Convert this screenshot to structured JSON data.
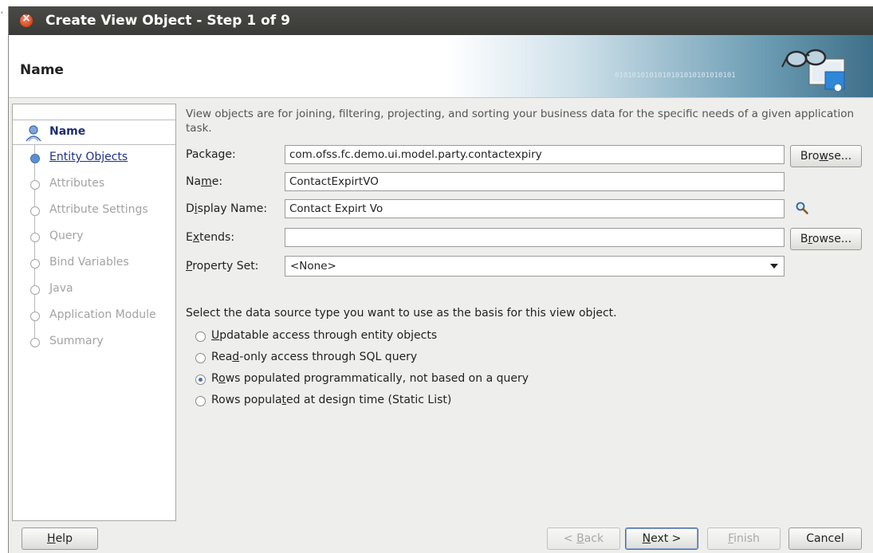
{
  "window": {
    "title": "Create View Object - Step 1 of 9",
    "header_title": "Name",
    "header_bits": "0101010101010101010101010101"
  },
  "steps": [
    {
      "label": "Name",
      "state": "current"
    },
    {
      "label": "Entity Objects",
      "state": "link"
    },
    {
      "label": "Attributes",
      "state": "disabled"
    },
    {
      "label": "Attribute Settings",
      "state": "disabled"
    },
    {
      "label": "Query",
      "state": "disabled"
    },
    {
      "label": "Bind Variables",
      "state": "disabled"
    },
    {
      "label": "Java",
      "state": "disabled"
    },
    {
      "label": "Application Module",
      "state": "disabled"
    },
    {
      "label": "Summary",
      "state": "disabled"
    }
  ],
  "intro_text": "View objects are for joining, filtering, projecting, and sorting your business data for the specific needs of a given application task.",
  "form": {
    "package_label": "Package:",
    "package_value": "com.ofss.fc.demo.ui.model.party.contactexpiry",
    "name_label_pre": "Na",
    "name_label_u": "m",
    "name_label_post": "e:",
    "name_value": "ContactExpirtVO",
    "display_label_pre": "D",
    "display_label_u": "i",
    "display_label_post": "splay Name:",
    "display_value": "Contact Expirt Vo",
    "extends_label_pre": "E",
    "extends_label_u": "x",
    "extends_label_post": "tends:",
    "extends_value": "",
    "property_label_u": "P",
    "property_label_post": "roperty Set:",
    "property_value": "<None>"
  },
  "browse_labels": {
    "package_pre": "Bro",
    "package_u": "w",
    "package_post": "se...",
    "extends_pre": "B",
    "extends_u": "r",
    "extends_post": "owse..."
  },
  "datasource": {
    "prompt": "Select the data source type you want to use as the basis for this view object.",
    "options": [
      {
        "pre": "",
        "u": "U",
        "post": "pdatable access through entity objects",
        "checked": false
      },
      {
        "pre": "Rea",
        "u": "d",
        "post": "-only access through SQL query",
        "checked": false
      },
      {
        "pre": "R",
        "u": "o",
        "post": "ws populated programmatically, not based on a query",
        "checked": true
      },
      {
        "pre": "Rows popula",
        "u": "t",
        "post": "ed at design time (Static List)",
        "checked": false
      }
    ]
  },
  "footer": {
    "help_u": "H",
    "help_post": "elp",
    "back_pre": "< ",
    "back_u": "B",
    "back_post": "ack",
    "next_u": "N",
    "next_post": "ext >",
    "finish_u": "F",
    "finish_post": "inish",
    "cancel": "Cancel"
  },
  "colors": {
    "title_bar": "#3f3f3c",
    "close_button": "#e05a2f",
    "current_step": "#1e2e70",
    "link_step": "#1d2f8a",
    "disabled_text": "#a3a3a3"
  },
  "icons": [
    "close-icon",
    "current-step-icon",
    "search-icon",
    "wizard-glasses-icon",
    "chevron-down-icon"
  ]
}
